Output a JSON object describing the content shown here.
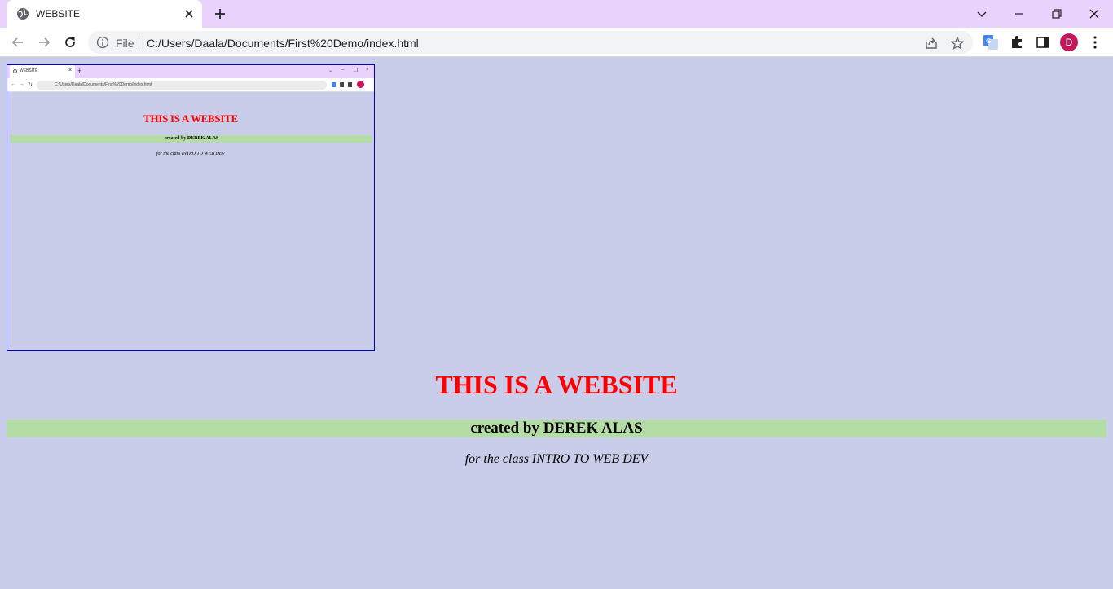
{
  "browser": {
    "tab_title": "WEBSITE",
    "omnibox_scheme_label": "File",
    "url": "C:/Users/Daala/Documents/First%20Demo/index.html",
    "profile_initial": "D",
    "colors": {
      "titlebar": "#e9d3fc",
      "avatar": "#c2185b"
    }
  },
  "page": {
    "background": "#cacdea",
    "heading": "THIS IS A WEBSITE",
    "creator": "created by DEREK ALAS",
    "class_line": "for the class INTRO TO WEB DEV",
    "colors": {
      "heading": "#ff0000",
      "creator_bar": "#b4dda5",
      "image_border": "#0000cc"
    },
    "embedded_screenshot": {
      "tab_title": "WEBSITE",
      "omnibox_scheme_label": "File",
      "url": "C:/Users/Daala/Documents/First%20Demo/index.html",
      "heading": "THIS IS A WEBSITE",
      "creator": "created by DEREK ALAS",
      "class_line": "for the class INTRO TO WEB DEV"
    }
  }
}
